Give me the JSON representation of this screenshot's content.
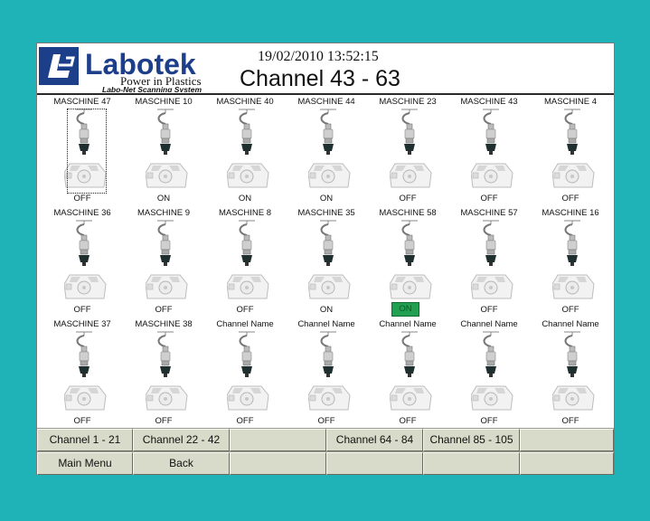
{
  "header": {
    "brand": "Labotek",
    "tagline": "Power in Plastics",
    "subtagline": "Labo-Net Scanning System",
    "datetime": "19/02/2010 13:52:15",
    "title": "Channel 43 - 63"
  },
  "colors": {
    "background": "#1fb3b8",
    "brand_blue": "#1d3f8a",
    "status_on": "#20a050"
  },
  "icons": {
    "machine": "dryer-machine-icon",
    "logo": "labotek-logo-icon"
  },
  "machines": [
    {
      "name": "MASCHINE 47",
      "status": "OFF",
      "selected": true
    },
    {
      "name": "MASCHINE 10",
      "status": "ON"
    },
    {
      "name": "MASCHINE 40",
      "status": "ON"
    },
    {
      "name": "MASCHINE 44",
      "status": "ON"
    },
    {
      "name": "MASCHINE 23",
      "status": "OFF"
    },
    {
      "name": "MASCHINE 43",
      "status": "OFF"
    },
    {
      "name": "MASCHINE 4",
      "status": "OFF"
    },
    {
      "name": "MASCHINE 36",
      "status": "OFF"
    },
    {
      "name": "MASCHINE 9",
      "status": "OFF"
    },
    {
      "name": "MASCHINE 8",
      "status": "OFF"
    },
    {
      "name": "MASCHINE 35",
      "status": "ON"
    },
    {
      "name": "MASCHINE 58",
      "status": "ON",
      "highlight": true
    },
    {
      "name": "MASCHINE 57",
      "status": "OFF"
    },
    {
      "name": "MASCHINE 16",
      "status": "OFF"
    },
    {
      "name": "MASCHINE 37",
      "status": "OFF"
    },
    {
      "name": "MASCHINE 38",
      "status": "OFF"
    },
    {
      "name": "Channel Name",
      "status": "OFF"
    },
    {
      "name": "Channel Name",
      "status": "OFF"
    },
    {
      "name": "Channel Name",
      "status": "OFF"
    },
    {
      "name": "Channel Name",
      "status": "OFF"
    },
    {
      "name": "Channel Name",
      "status": "OFF"
    }
  ],
  "buttons": [
    [
      "Channel 1 - 21",
      "Channel 22 - 42",
      "",
      "Channel 64 - 84",
      "Channel 85 - 105",
      ""
    ],
    [
      "Main Menu",
      "Back",
      "",
      "",
      "",
      ""
    ]
  ]
}
